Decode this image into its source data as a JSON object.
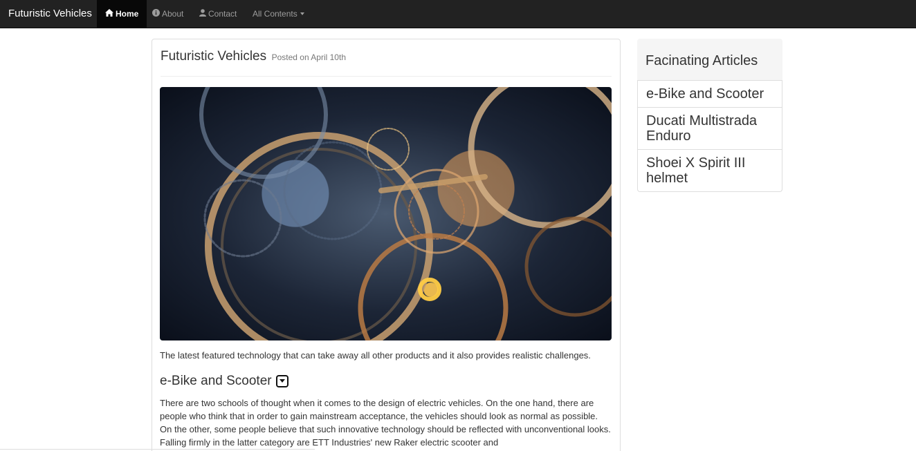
{
  "navbar": {
    "brand": "Futuristic Vehicles",
    "items": [
      {
        "label": "Home",
        "icon": "home-icon",
        "active": true
      },
      {
        "label": "About",
        "icon": "info-icon",
        "active": false
      },
      {
        "label": "Contact",
        "icon": "user-icon",
        "active": false
      },
      {
        "label": "All Contents",
        "icon": "caret-down-icon",
        "active": false
      }
    ]
  },
  "main": {
    "title": "Futuristic Vehicles",
    "posted": "Posted on April 10th",
    "intro": "The latest featured technology that can take away all other products and it also provides realistic challenges.",
    "section_title": "e-Bike and Scooter",
    "section_body": "There are two schools of thought when it comes to the design of electric vehicles. On the one hand, there are people who think that in order to gain mainstream acceptance, the vehicles should look as normal as possible. On the other, some people believe that such innovative technology should be reflected with unconventional looks. Falling firmly in the latter category are ETT Industries' new Raker electric scooter and"
  },
  "sidebar": {
    "title": "Facinating Articles",
    "items": [
      {
        "label": "e-Bike and Scooter"
      },
      {
        "label": "Ducati Multistrada Enduro"
      },
      {
        "label": "Shoei X Spirit III helmet"
      }
    ]
  },
  "colors": {
    "navbar_bg": "#222222",
    "navbar_active_bg": "#080808",
    "text": "#333333",
    "muted": "#777777"
  }
}
